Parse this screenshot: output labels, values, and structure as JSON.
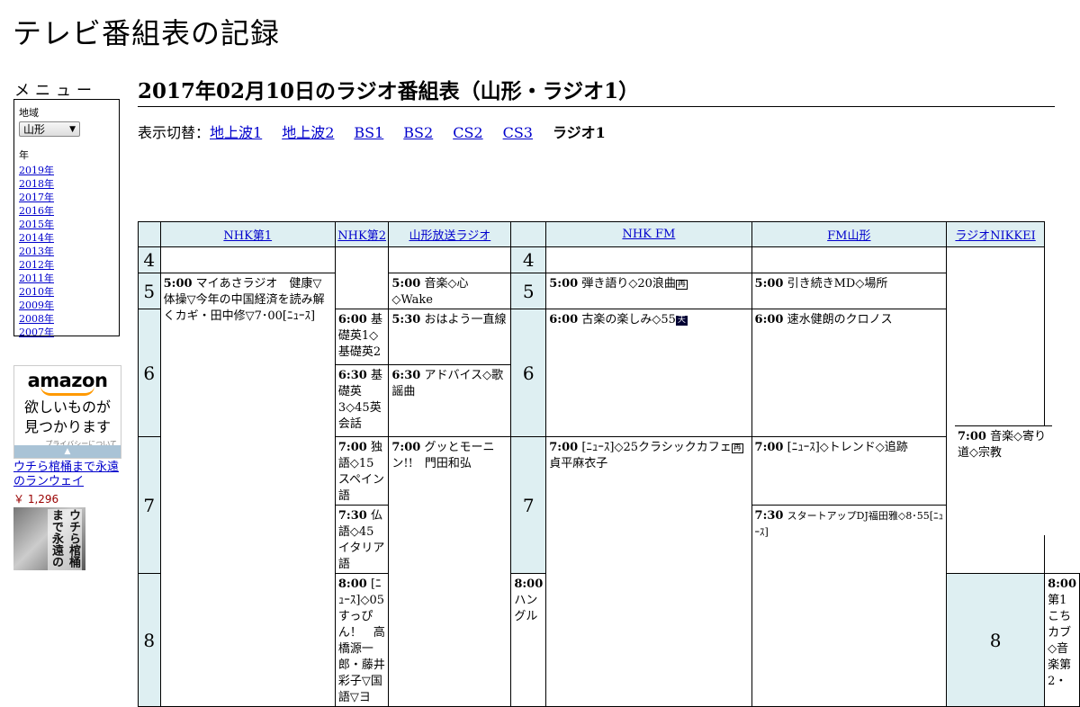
{
  "site_title": "テレビ番組表の記録",
  "menu": {
    "title": "メニュー",
    "region_label": "地域",
    "region_value": "山形",
    "year_label": "年",
    "years": [
      "2019年",
      "2018年",
      "2017年",
      "2016年",
      "2015年",
      "2014年",
      "2013年",
      "2012年",
      "2011年",
      "2010年",
      "2009年",
      "2008年",
      "2007年"
    ]
  },
  "ad": {
    "logo": "amazon",
    "line1": "欲しいものが",
    "line2": "見つかります",
    "privacy": "プライバシーについて",
    "book_title": "ウチら棺桶まで永遠のランウェイ",
    "book_price": "￥ 1,296",
    "cover_text": "ウチら棺桶まで永遠の"
  },
  "page_title": "2017年02月10日のラジオ番組表（山形・ラジオ1）",
  "switch": {
    "label": "表示切替：",
    "links": [
      "地上波1",
      "地上波2",
      "BS1",
      "BS2",
      "CS2",
      "CS3"
    ],
    "current": "ラジオ1"
  },
  "channels": [
    "NHK第1",
    "NHK第2",
    "山形放送ラジオ",
    "NHK FM",
    "FM山形",
    "ラジオNIKKEI"
  ],
  "hours": [
    "4",
    "5",
    "6",
    "7",
    "8"
  ],
  "programs": {
    "nhk1_0500": {
      "time": "5:00",
      "title": "マイあさラジオ　健康▽体操▽今年の中国経済を読み解くカギ・田中修▽7･00[ﾆｭｰｽ]"
    },
    "nhk1_0800": {
      "time": "8:00",
      "title": "[ﾆｭｰｽ]◇05すっぴん！　高橋源一郎・藤井彩子▽国語▽ヨ"
    },
    "nhk2_0600": {
      "time": "6:00",
      "title": "基礎英1◇基礎英2"
    },
    "nhk2_0630": {
      "time": "6:30",
      "title": "基礎英3◇45英会話"
    },
    "nhk2_0700": {
      "time": "7:00",
      "title": "独語◇15スペイン語"
    },
    "nhk2_0730": {
      "time": "7:30",
      "title": "仏語◇45イタリア語"
    },
    "nhk2_0800": {
      "time": "8:00",
      "title": "ハングル"
    },
    "ybc_0500": {
      "time": "5:00",
      "title": "音楽◇心◇Wake"
    },
    "ybc_0530": {
      "time": "5:30",
      "title": "おはよう一直線"
    },
    "ybc_0630": {
      "time": "6:30",
      "title": "アドバイス◇歌謡曲"
    },
    "ybc_0700": {
      "time": "7:00",
      "title": "グッとモーニン!!　門田和弘"
    },
    "fm_0500": {
      "time": "5:00",
      "title": "弾き語り◇20浪曲",
      "badge": "再"
    },
    "fm_0600": {
      "time": "6:00",
      "title": "古楽の楽しみ◇55",
      "badge": "天"
    },
    "fm_0700": {
      "time": "7:00",
      "title": "[ﾆｭｰｽ]◇25クラシックカフェ",
      "badge": "再",
      "title2": "貞平麻衣子"
    },
    "fmy_0500": {
      "time": "5:00",
      "title": "引き続きMD◇場所"
    },
    "fmy_0600": {
      "time": "6:00",
      "title": "速水健朗のクロノス"
    },
    "fmy_0700": {
      "time": "7:00",
      "title": "[ﾆｭｰｽ]◇トレンド◇追跡"
    },
    "fmy_0730": {
      "time": "7:30",
      "title": "スタートアップDJ福田雅◇8･55[ﾆｭｰｽ]"
    },
    "nikkei_0700": {
      "time": "7:00",
      "title": "音楽◇寄り道◇宗教"
    },
    "nikkei_0800": {
      "time": "8:00",
      "title": "第1こちカブ◇音楽第2・"
    }
  }
}
